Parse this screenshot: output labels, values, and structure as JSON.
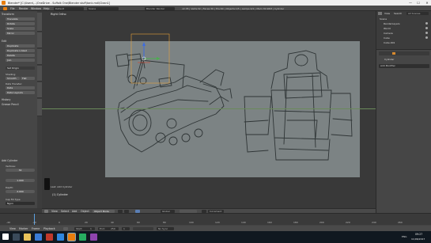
{
  "window": {
    "title": "Blender* [C:\\Users\\...\\OneDrive - Suffolk One\\Blender stuff\\tank.mdl\\Clean1]",
    "controls": [
      "—",
      "☐",
      "✕"
    ]
  },
  "menubar": {
    "items": [
      "File",
      "Render",
      "Window",
      "Help"
    ],
    "layout": "Default",
    "scene": "Scene",
    "engine": "Blender Render",
    "stats": "v2.78 | Verts:32 | Faces:30 | Tris:60 | Objects:1/5 | Lamps:0/1 | Mem:30.96M | Cylinder"
  },
  "toolshelf": {
    "transform_header": "Transform",
    "transform_buttons": [
      "Translate",
      "Rotate",
      "Scale",
      "Mirror"
    ],
    "edit_header": "Edit",
    "edit_buttons": [
      "Duplicate",
      "Duplicate Linked",
      "Delete",
      "Join"
    ],
    "set_origin": "Set Origin",
    "shading_label": "Shading:",
    "smooth_label": "Smooth",
    "flat_label": "Flat",
    "data_transfer_label": "Data Transfer:",
    "data_label": "Data",
    "data_layout_label": "Data Layouts",
    "history_header": "History",
    "grease_header": "Grease Pencil",
    "add_cylinder_header": "Add Cylinder",
    "vertices_label": "Vertices:",
    "vertices_value": "32",
    "radius_value": "1.000",
    "depth_label": "Depth:",
    "depth_value": "2.000",
    "cap_fill_label": "Cap Fill Type",
    "cap_fill_value": "Ngon"
  },
  "viewport": {
    "view_label": "Right Ortho",
    "object_name": "(1) Cylinder",
    "last_op": "Last: Add Cylinder",
    "header_items": [
      "View",
      "Select",
      "Add",
      "Object"
    ],
    "mode": "Object Mode",
    "pivot": "Global",
    "layers": "",
    "snap": "Increment"
  },
  "outliner": {
    "menu": [
      "View",
      "Search",
      "All Scenes"
    ],
    "rows": [
      "Scene",
      "RenderLayers",
      "World",
      "Camera",
      "Cube",
      "Cube.001"
    ]
  },
  "properties": {
    "object_label": "Cylinder",
    "modifier_button": "Add Modifier"
  },
  "timeline": {
    "menu": [
      "View",
      "Marker",
      "Frame",
      "Playback"
    ],
    "start_label": "Start:",
    "start_value": "1",
    "end_label": "End:",
    "end_value": "250",
    "current_frame": "1",
    "sync": "No Sync",
    "ticks": [
      "-40",
      "-20",
      "0",
      "20",
      "40",
      "60",
      "80",
      "100",
      "120",
      "140",
      "160",
      "180",
      "200",
      "220",
      "240",
      "260"
    ]
  },
  "taskbar": {
    "time": "09:27",
    "date": "11/06/2017",
    "lang": "ENG"
  },
  "colors": {
    "sheet": "#7c8384",
    "sketch": "#2f3536",
    "accent": "#e87d0d",
    "gizmo_x": "#d9412b",
    "gizmo_y": "#4caf50",
    "gizmo_z": "#3d6be0"
  }
}
